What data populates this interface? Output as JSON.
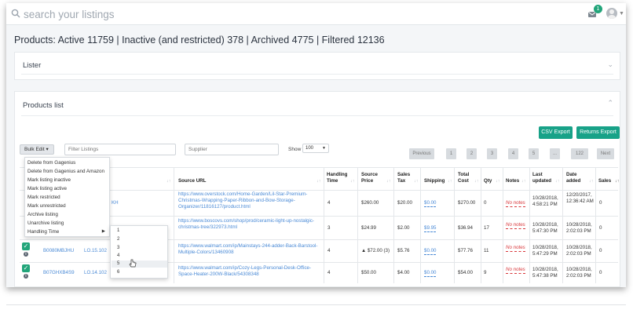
{
  "search": {
    "placeholder": "search your listings"
  },
  "notifications": {
    "count": "1"
  },
  "title": "Products: Active 11759 | Inactive (and restricted) 378 | Archived 4775 | Filtered 12136",
  "lister_panel": {
    "title": "Lister"
  },
  "products_panel": {
    "title": "Products list"
  },
  "toolbar": {
    "csv_export": "CSV Export",
    "returns_export": "Returns Export",
    "bulk_edit": "Bulk Edit ▾",
    "filter_placeholder": "Filter Listings",
    "supplier_placeholder": "Supplier",
    "show_label": "Show",
    "show_value": "100"
  },
  "pagination": [
    "Previous",
    "1",
    "2",
    "3",
    "4",
    "5",
    "...",
    "122",
    "Next"
  ],
  "bulk_menu": [
    "Delete from Gagenius",
    "Delete from Gagenius and Amazon",
    "Mark listing inactive",
    "Mark listing active",
    "Mark restricted",
    "Mark unrestricted",
    "Archive listing",
    "Unarchive listing",
    "Handling Time"
  ],
  "handling_submenu": [
    "1",
    "2",
    "3",
    "4",
    "5",
    "6"
  ],
  "columns": {
    "source_url": "Source URL",
    "handling_time": "Handling Time",
    "source_price": "Source Price",
    "sales_tax": "Sales Tax",
    "shipping": "Shipping",
    "total_cost": "Total Cost",
    "qty": "Qty",
    "notes": "Notes",
    "last_updated": "Last updated",
    "date_added": "Date added",
    "sales": "Sales"
  },
  "rows": [
    {
      "asin": "",
      "sku": "",
      "sku_partial": "KH",
      "url": "https://www.overstock.com/Home-Garden/Lil-Star-Premium-Christmas-Wrapping-Paper-Ribbon-and-Bow-Storage-Organizer/11816127/product.html",
      "handling": "4",
      "price": "$260.00",
      "tax": "$20.00",
      "shipping": "$0.00",
      "total": "$270.00",
      "qty": "0",
      "notes": "No notes",
      "updated": "10/28/2018, 4:58:21 PM",
      "added": "12/20/2017, 12:36:42 AM",
      "sales": "0"
    },
    {
      "asin": "",
      "sku": "",
      "sku_partial": "",
      "url": "https://www.boscovs.com/shop/prod/ceramic-light-up-nostalgic-christmas-tree/322973.html",
      "handling": "3",
      "price": "$24.99",
      "tax": "$2.00",
      "shipping": "$9.95",
      "total": "$36.94",
      "qty": "17",
      "notes": "No notes",
      "updated": "10/28/2018, 5:47:30 PM",
      "added": "10/28/2018, 2:02:03 PM",
      "sales": "0"
    },
    {
      "asin": "B0080MBJHU",
      "sku": "LO.15.102",
      "url": "https://www.walmart.com/ip/Mainstays-244-adder-Back-Barstool-Multiple-Colors/13460908",
      "handling": "4",
      "price": "$72.00 (3)",
      "tax": "$5.76",
      "shipping": "$0.00",
      "total": "$77.76",
      "qty": "11",
      "notes": "No notes",
      "updated": "10/28/2018, 5:47:29 PM",
      "added": "10/28/2018, 2:02:03 PM",
      "sales": "0"
    },
    {
      "asin": "B07GHXB4S9",
      "sku": "LO.14.102",
      "url": "https://www.walmart.com/ip/Cozy-Legs-Personal-Desk-Office-Space-Heater-200W-Black/54308348",
      "handling": "4",
      "price": "$50.00",
      "tax": "$4.00",
      "shipping": "$0.00",
      "total": "$54.00",
      "qty": "9",
      "notes": "No notes",
      "updated": "10/28/2018, 5:47:38 PM",
      "added": "10/28/2018, 2:02:03 PM",
      "sales": "0"
    }
  ],
  "colors": {
    "accent": "#18a288",
    "link": "#4a8ad6",
    "note": "#d8363a"
  }
}
